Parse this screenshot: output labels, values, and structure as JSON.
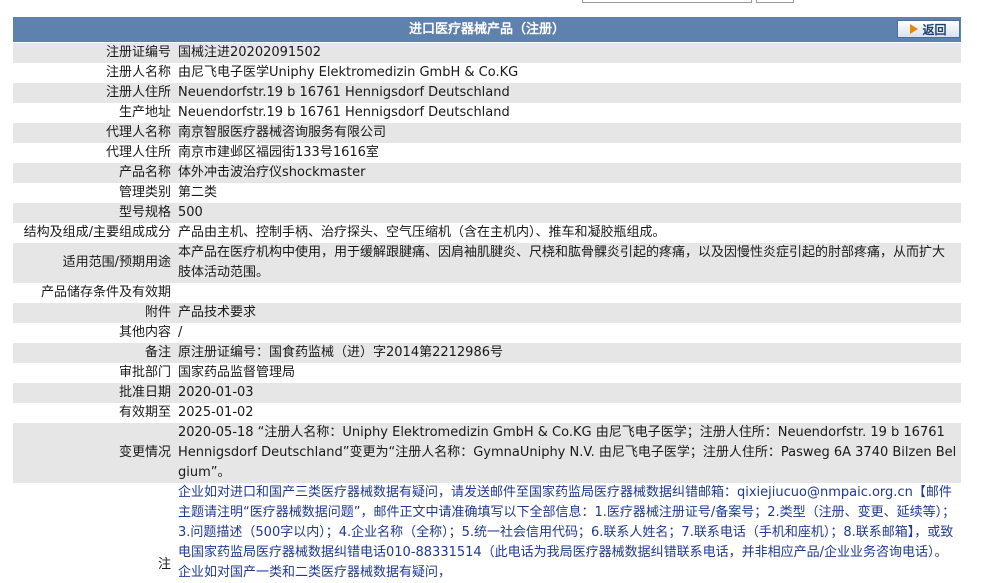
{
  "header": {
    "title": "进口医疗器械产品（注册）",
    "back_label": "返回"
  },
  "rows": [
    {
      "label": "注册证编号",
      "value": "国械注进20202091502"
    },
    {
      "label": "注册人名称",
      "value": "由尼飞电子医学Uniphy Elektromedizin GmbH & Co.KG"
    },
    {
      "label": "注册人住所",
      "value": "Neuendorfstr.19 b 16761 Hennigsdorf Deutschland"
    },
    {
      "label": "生产地址",
      "value": "Neuendorfstr.19 b 16761 Hennigsdorf Deutschland"
    },
    {
      "label": "代理人名称",
      "value": "南京智服医疗器械咨询服务有限公司"
    },
    {
      "label": "代理人住所",
      "value": "南京市建邺区福园街133号1616室"
    },
    {
      "label": "产品名称",
      "value": "体外冲击波治疗仪shockmaster"
    },
    {
      "label": "管理类别",
      "value": "第二类"
    },
    {
      "label": "型号规格",
      "value": "500"
    },
    {
      "label": "结构及组成/主要组成成分",
      "value": "产品由主机、控制手柄、治疗探头、空气压缩机（含在主机内）、推车和凝胶瓶组成。"
    },
    {
      "label": "适用范围/预期用途",
      "value": "本产品在医疗机构中使用，用于缓解跟腱痛、因肩袖肌腱炎、尺桡和肱骨髁炎引起的疼痛，以及因慢性炎症引起的肘部疼痛，从而扩大肢体活动范围。"
    },
    {
      "label": "产品储存条件及有效期",
      "value": ""
    },
    {
      "label": "附件",
      "value": "产品技术要求"
    },
    {
      "label": "其他内容",
      "value": "/"
    },
    {
      "label": "备注",
      "value": "原注册证编号：国食药监械（进）字2014第2212986号"
    },
    {
      "label": "审批部门",
      "value": "国家药品监督管理局"
    },
    {
      "label": "批准日期",
      "value": "2020-01-03"
    },
    {
      "label": "有效期至",
      "value": "2025-01-02"
    },
    {
      "label": "变更情况",
      "value": "2020-05-18 “注册人名称：Uniphy Elektromedizin GmbH & Co.KG 由尼飞电子医学；注册人住所：Neuendorfstr. 19 b 16761 Hennigsdorf Deutschland”变更为“注册人名称：GymnaUniphy N.V. 由尼飞电子医学；注册人住所：Pasweg 6A 3740 Bilzen Belgium”。"
    }
  ],
  "note": {
    "label": "注",
    "text": "企业如对进口和国产三类医疗器械数据有疑问，请发送邮件至国家药监局医疗器械数据纠错邮箱：qixiejiucuo@nmpaic.org.cn【邮件主题请注明“医疗器械数据问题”，邮件正文中请准确填写以下全部信息：1.医疗器械注册证号/备案号；2.类型（注册、变更、延续等）；3.问题描述（500字以内）；4.企业名称（全称）；5.统一社会信用代码；6.联系人姓名；7.联系电话（手机和座机）；8.联系邮箱】，或致电国家药监局医疗器械数据纠错电话010-88331514（此电话为我局医疗器械数据纠错联系电话，并非相应产品/企业业务咨询电话）。企业如对国产一类和二类医疗器械数据有疑问，"
  },
  "colors": {
    "title_bg": "#5e81ad",
    "row_gray": "#e6e6e6",
    "note_text": "#1f3a93",
    "back_arrow": "#e68a00"
  }
}
